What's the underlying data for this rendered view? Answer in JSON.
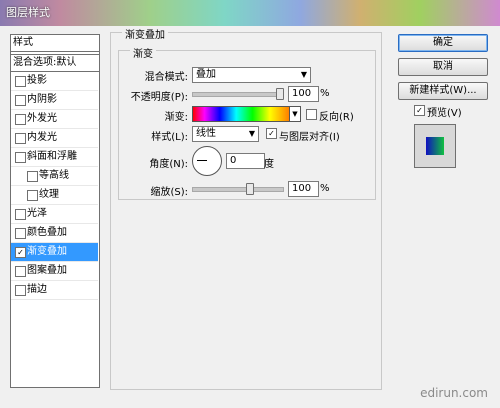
{
  "window": {
    "title": "图层样式"
  },
  "sidebar": {
    "header": "样式",
    "blend_default": "混合选项:默认",
    "items": [
      {
        "label": "投影",
        "checked": false,
        "indent": false
      },
      {
        "label": "内阴影",
        "checked": false,
        "indent": false
      },
      {
        "label": "外发光",
        "checked": false,
        "indent": false
      },
      {
        "label": "内发光",
        "checked": false,
        "indent": false
      },
      {
        "label": "斜面和浮雕",
        "checked": false,
        "indent": false
      },
      {
        "label": "等高线",
        "checked": false,
        "indent": true
      },
      {
        "label": "纹理",
        "checked": false,
        "indent": true
      },
      {
        "label": "光泽",
        "checked": false,
        "indent": false
      },
      {
        "label": "颜色叠加",
        "checked": false,
        "indent": false
      },
      {
        "label": "渐变叠加",
        "checked": true,
        "indent": false,
        "selected": true
      },
      {
        "label": "图案叠加",
        "checked": false,
        "indent": false
      },
      {
        "label": "描边",
        "checked": false,
        "indent": false
      }
    ]
  },
  "panel": {
    "section_title": "渐变叠加",
    "subsection_title": "渐变",
    "blend_mode": {
      "label": "混合模式:",
      "value": "叠加"
    },
    "opacity": {
      "label": "不透明度(P):",
      "value": "100",
      "unit": "%",
      "level_percent": 100
    },
    "gradient": {
      "label": "渐变:"
    },
    "reverse": {
      "label": "反向(R)",
      "checked": false
    },
    "style": {
      "label": "样式(L):",
      "value": "线性"
    },
    "align_layer": {
      "label": "与图层对齐(I)",
      "checked": true
    },
    "angle": {
      "label": "角度(N):",
      "value": "0",
      "unit": "度"
    },
    "scale": {
      "label": "缩放(S):",
      "value": "100",
      "unit": "%",
      "level_percent": 100
    }
  },
  "buttons": {
    "ok": "确定",
    "cancel": "取消",
    "new_style": "新建样式(W)...",
    "preview_label": "预览(V)",
    "preview_checked": true
  },
  "watermark": "edirun.com",
  "icons": {
    "check": "check-icon",
    "dropdown": "chevron-down-icon",
    "angle": "angle-dial-icon"
  },
  "colors": {
    "selection": "#3399ff",
    "preview_gradient_start": "#1010c0",
    "preview_gradient_end": "#10c040"
  }
}
